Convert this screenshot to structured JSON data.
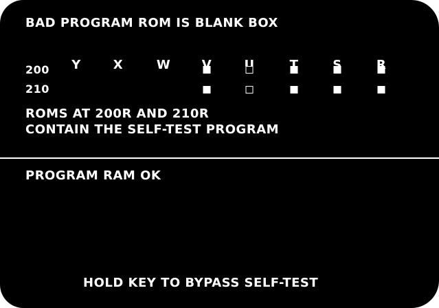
{
  "screen": {
    "title": "BAD PROGRAM ROM IS BLANK BOX",
    "columns": [
      "Y",
      "X",
      "W",
      "V",
      "U",
      "T",
      "S",
      "R"
    ],
    "rows": [
      {
        "label": "200",
        "cells": [
          "none",
          "none",
          "none",
          "filled",
          "blank",
          "filled",
          "filled",
          "filled"
        ]
      },
      {
        "label": "210",
        "cells": [
          "none",
          "none",
          "none",
          "filled",
          "blank",
          "filled",
          "filled",
          "filled"
        ]
      }
    ],
    "note_line1": "ROMS AT 200R AND 210R",
    "note_line2": "CONTAIN THE SELF-TEST PROGRAM",
    "ram_status": "PROGRAM RAM OK",
    "footer": "HOLD KEY TO BYPASS SELF-TEST"
  },
  "colors": {
    "background": "#000000",
    "text": "#ffffff"
  }
}
